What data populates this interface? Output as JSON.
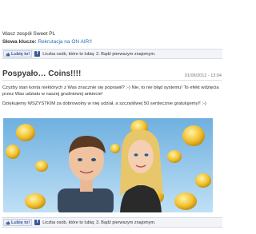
{
  "signature": {
    "line1": "Wasz zespół Sweet PL",
    "label": "Słowa klucze:",
    "keywords": "Rekrutacja na ON AIR!!"
  },
  "facebook_top": {
    "like_label": "Lubię to!",
    "text": "Liczba osób, które to lubią: 2. Bądź pierwszym znajomym."
  },
  "post": {
    "title": "Pospyało… Coins!!!!",
    "date": "01/09/2012 - 13:04",
    "paragraph1": "Czyżby stan konta niektórych z Was znacznie się poprawił? :-) Nie, to nie błąd systemu! To efekt wdzięcia przez Was udziału w naszej grudniowej ankiecie!",
    "paragraph2": "Dziękujemy WSZYSTKIM za dobrowolny w niej udział, a szczęśliwej 50 serdecznie gratulujemy!! :-)"
  },
  "facebook_bottom": {
    "like_label": "Lubię to!",
    "text": "Liczba osób, które to lubią: 3. Bądź pierwszym znajomym."
  },
  "colors": {
    "link": "#2a6bb0",
    "facebook": "#3b5998",
    "sky": "#8fc4ea",
    "coin": "#f2c12e"
  },
  "icons": [
    "thumbs-up-icon",
    "facebook-logo-icon"
  ]
}
